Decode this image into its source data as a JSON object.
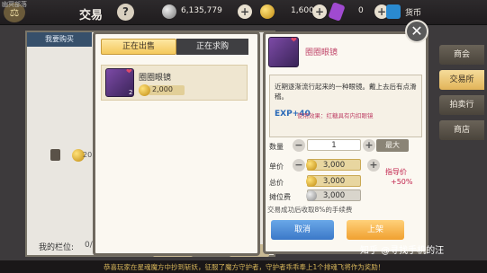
{
  "topbar": {
    "app_tag": "幽冥部落",
    "title": "交易",
    "help": "?",
    "silver_amount": "6,135,779",
    "add": "+",
    "gold_amount": "1,600",
    "gem_amount": "0",
    "currency_label": "货币"
  },
  "background": {
    "tab_label": "我要购买",
    "price_fragment": "20",
    "slot_label": "我的栏位:",
    "slot_value": "0/4"
  },
  "listing": {
    "tabs": [
      "正在出售",
      "正在求购"
    ],
    "item_name": "圈圈眼镜",
    "item_qty": "2",
    "item_price": "2,000"
  },
  "detail": {
    "name": "圈圈眼镜",
    "description": "近期逐渐流行起来的一种眼镜。戴上去后有点滑稽。",
    "exp_badge": "EXP+40",
    "effect_text": "使用效果：红糖具有内扣眼镜",
    "qty_label": "数量",
    "qty_value": "1",
    "max_label": "最大",
    "unit_price_label": "单价",
    "unit_price_value": "3,000",
    "total_label": "总价",
    "total_value": "3,000",
    "stall_fee_label": "摊位费",
    "stall_fee_value": "3,000",
    "guide_label": "指导价",
    "percent_label": "+50%",
    "fee_note": "交易成功后收取8%的手续费",
    "cancel_label": "取消",
    "list_label": "上架",
    "minus": "−",
    "plus": "+"
  },
  "close_glyph": "✕",
  "side_tabs": [
    "商会",
    "交易所",
    "拍卖行",
    "商店"
  ],
  "watermark": "知乎 @寻找手机的汪",
  "ticker": "恭喜玩家在星魂魔方中抄到斩妖，征服了魔方守护者，守护者乖乖奉上1个排魂飞将作为奖励！"
}
